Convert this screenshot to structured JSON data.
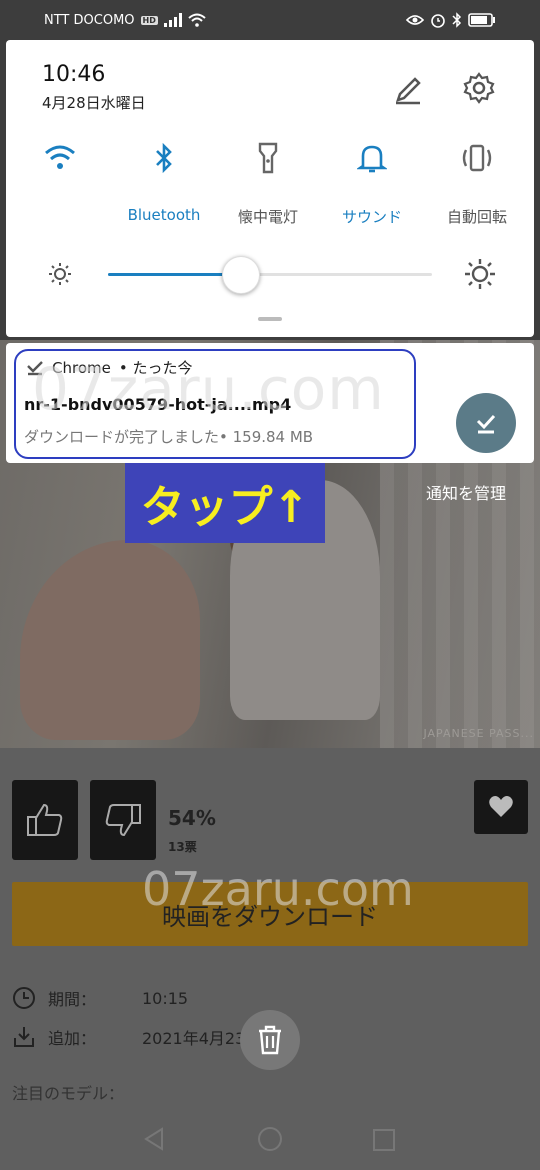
{
  "status_bar": {
    "carrier": "NTT DOCOMO",
    "hd": "HD"
  },
  "quick_settings": {
    "time": "10:46",
    "date": "4月28日水曜日",
    "toggles": [
      {
        "label": "",
        "icon": "wifi-icon",
        "on": true
      },
      {
        "label": "Bluetooth",
        "icon": "bluetooth-icon",
        "on": true
      },
      {
        "label": "懐中電灯",
        "icon": "flashlight-icon",
        "on": false
      },
      {
        "label": "サウンド",
        "icon": "bell-icon",
        "on": true
      },
      {
        "label": "自動回転",
        "icon": "auto-rotate-icon",
        "on": false
      }
    ],
    "brightness": 0.41,
    "accent": "#1a7fc0"
  },
  "notification": {
    "app": "Chrome",
    "time": "• たった今",
    "title": "nr-1-bndv00579-hot-ja....mp4",
    "subtitle": "ダウンロードが完了しました• 159.84 MB"
  },
  "annotation": {
    "tap_label": "タップ↑",
    "watermark": "07zaru.com"
  },
  "manage_notifications": "通知を管理",
  "video": {
    "watermark": "JAPANESE PASS..."
  },
  "page": {
    "rating_percent": "54%",
    "votes": "13票",
    "download_button": "映画をダウンロード",
    "duration_key": "期間：",
    "duration_value": "10:15",
    "added_key": "追加：",
    "added_value": "2021年4月23日",
    "models_label": "注目のモデル："
  }
}
